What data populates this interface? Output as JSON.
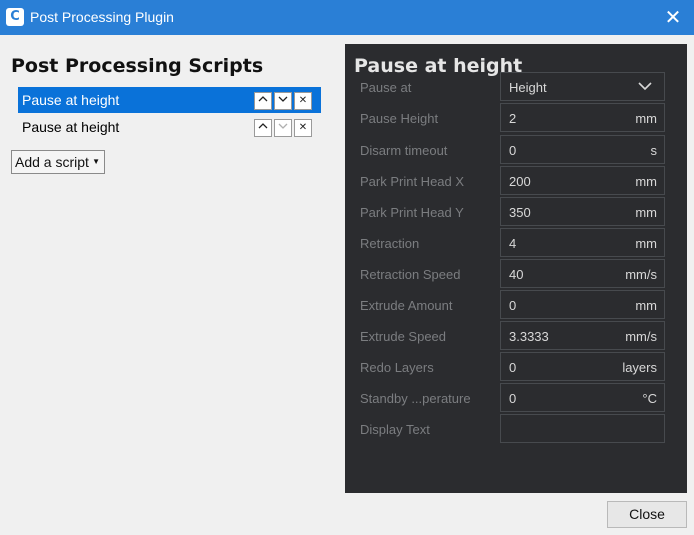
{
  "window": {
    "title": "Post Processing Plugin",
    "icon": "cura-icon",
    "close_icon": "close-icon"
  },
  "scripts": {
    "heading": "Post Processing Scripts",
    "items": [
      {
        "label": "Pause at height",
        "selected": true
      },
      {
        "label": "Pause at height",
        "selected": false
      }
    ],
    "add_label": "Add a script"
  },
  "settings": {
    "heading": "Pause at height",
    "rows": [
      {
        "label": "Pause at",
        "value": "Height",
        "unit": "",
        "type": "dropdown"
      },
      {
        "label": "Pause Height",
        "value": "2",
        "unit": "mm"
      },
      {
        "label": "Disarm timeout",
        "value": "0",
        "unit": "s"
      },
      {
        "label": "Park Print Head X",
        "value": "200",
        "unit": "mm"
      },
      {
        "label": "Park Print Head Y",
        "value": "350",
        "unit": "mm"
      },
      {
        "label": "Retraction",
        "value": "4",
        "unit": "mm"
      },
      {
        "label": "Retraction Speed",
        "value": "40",
        "unit": "mm/s"
      },
      {
        "label": "Extrude Amount",
        "value": "0",
        "unit": "mm"
      },
      {
        "label": "Extrude Speed",
        "value": "3.3333",
        "unit": "mm/s"
      },
      {
        "label": "Redo Layers",
        "value": "0",
        "unit": "layers"
      },
      {
        "label": "Standby ...perature",
        "value": "0",
        "unit": "°C"
      },
      {
        "label": "Display Text",
        "value": "",
        "unit": ""
      }
    ]
  },
  "footer": {
    "close_label": "Close"
  },
  "colors": {
    "titlebar": "#2a7fd6",
    "selection": "#0a72d9",
    "panel_bg": "#2b2c2f"
  }
}
